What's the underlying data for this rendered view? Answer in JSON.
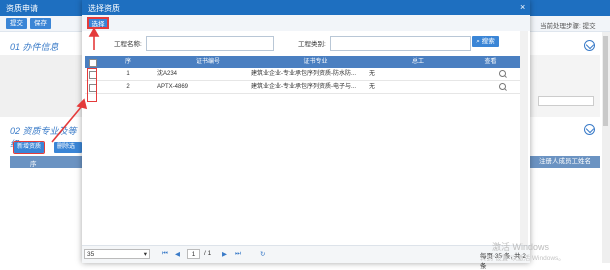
{
  "background": {
    "window_title": "资质申请",
    "toolbar": {
      "submit_label": "提交",
      "save_label": "保存"
    },
    "current_step": "当前处理步骤: 提交",
    "section1_title": "01 办件信息",
    "section2_title": "02 资质专业及等级",
    "buttons": {
      "add_label": "新增资质",
      "delete_label": "删除选中"
    },
    "table": {
      "seq_header": "序",
      "right_header": "注册人成员工姓名"
    }
  },
  "modal": {
    "title": "选择资质",
    "close_glyph": "×",
    "select_label": "选择",
    "filters": {
      "project_name_label": "工程名称:",
      "project_name_value": "",
      "project_type_label": "工程类别:",
      "project_type_value": "",
      "search_label": "搜索"
    },
    "grid": {
      "headers": [
        "序",
        "证书编号",
        "证书专业",
        "总工",
        "查看"
      ],
      "rows": [
        {
          "seq": "1",
          "cert_no": "沈A234",
          "major": "建筑业企业-专业承包序列资质-防水防...",
          "chief": "无"
        },
        {
          "seq": "2",
          "cert_no": "APTX-4869",
          "major": "建筑业企业-专业承包序列资质-电子与...",
          "chief": "无"
        }
      ]
    },
    "pager": {
      "page_size": "35",
      "page_value": "1",
      "page_total": "/ 1",
      "summary": "每页 35 条, 共 2 条"
    }
  },
  "watermark": {
    "line1": "激活 Windows",
    "line2": "转到\"设置\"以激活 Windows。"
  },
  "colors": {
    "primary": "#1e6fc0",
    "header": "#4a7fc1",
    "button": "#3a85d6",
    "annotation": "#e43b3b"
  },
  "icons": {
    "close": "close-icon",
    "search": "search-icon",
    "view": "magnifier-icon"
  }
}
